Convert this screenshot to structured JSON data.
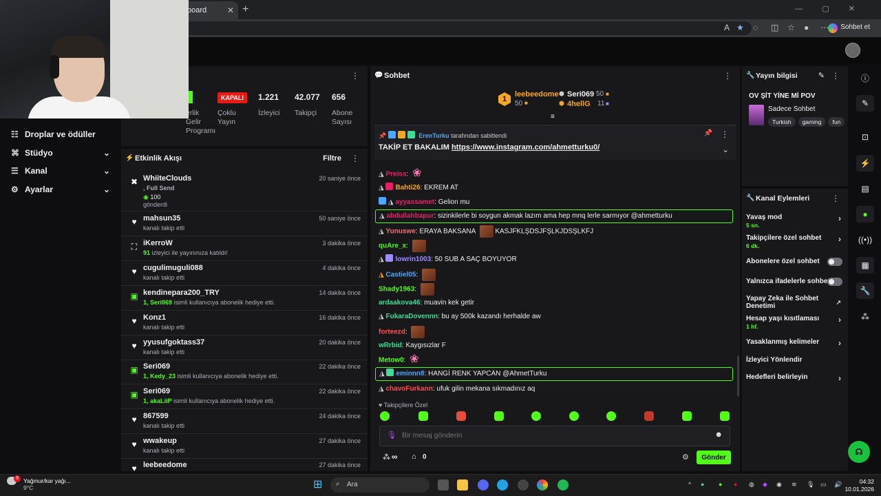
{
  "browser": {
    "tab_title": "board",
    "copilot_label": "Sohbet et"
  },
  "sidebar": {
    "items": [
      {
        "label": "Droplar ve ödüller",
        "icon": "gift-icon",
        "chevron": false
      },
      {
        "label": "Stüdyo",
        "icon": "studio-icon",
        "chevron": true
      },
      {
        "label": "Kanal",
        "icon": "channel-icon",
        "chevron": true
      },
      {
        "label": "Ayarlar",
        "icon": "gear-icon",
        "chevron": true
      }
    ]
  },
  "stats": {
    "partial_label_1": "erlik",
    "partial_label_2": "Gelir",
    "partial_label_3": "Programı",
    "status_badge": "KAPALI",
    "status_label_1": "Çoklu",
    "status_label_2": "Yayın",
    "viewers_value": "1.221",
    "viewers_label": "İzleyici",
    "followers_value": "42.077",
    "followers_label": "Takipçi",
    "subs_value": "656",
    "subs_label_1": "Abone",
    "subs_label_2": "Sayısı"
  },
  "activity": {
    "title": "Etkinlik Akışı",
    "filter_label": "Filtre",
    "events": [
      {
        "name": "WhiiteClouds",
        "desc_prefix": ", Full Send",
        "desc_line2": "100",
        "desc_line3": "gönderdi",
        "time": "20 saniye önce",
        "icon": "kick-icon"
      },
      {
        "name": "mahsun35",
        "desc": "kanalı takip etti",
        "time": "50 saniye önce",
        "icon": "heart-icon"
      },
      {
        "name": "iKerroW",
        "desc_green": "91",
        "desc": " izleyici ile yayınınıza katıldı!",
        "time": "3 dakika önce",
        "icon": "raid-icon"
      },
      {
        "name": "cugulimuguli088",
        "desc": "kanalı takip etti",
        "time": "4 dakika önce",
        "icon": "heart-icon"
      },
      {
        "name": "kendinepara200_TRY",
        "desc_green": "1, Seri069",
        "desc": " isimli kullanıcıya abonelik hediye etti.",
        "time": "14 dakika önce",
        "icon": "gift-icon"
      },
      {
        "name": "Konz1",
        "desc": "kanalı takip etti",
        "time": "16 dakika önce",
        "icon": "heart-icon"
      },
      {
        "name": "yyusufgoktass37",
        "desc": "kanalı takip etti",
        "time": "20 dakika önce",
        "icon": "heart-icon"
      },
      {
        "name": "Seri069",
        "desc_green": "1, Kedy_23",
        "desc": " isimli kullanıcıya abonelik hediye etti.",
        "time": "22 dakika önce",
        "icon": "gift-icon"
      },
      {
        "name": "Seri069",
        "desc_green": "1, akaLiiP",
        "desc": " isimli kullanıcıya abonelik hediye etti.",
        "time": "22 dakika önce",
        "icon": "gift-icon"
      },
      {
        "name": "867599",
        "desc": "kanalı takip etti",
        "time": "24 dakika önce",
        "icon": "heart-icon"
      },
      {
        "name": "wwakeup",
        "desc": "kanalı takip etti",
        "time": "27 dakika önce",
        "icon": "heart-icon"
      },
      {
        "name": "leebeedome",
        "desc": "",
        "time": "27 dakika önce",
        "icon": "heart-icon"
      }
    ]
  },
  "chat": {
    "title": "Sohbet",
    "leaderboard": {
      "first_name": "leebeedome",
      "first_rank": "1",
      "first_count": "50",
      "second_name": "Seri069",
      "second_count": "50",
      "third_name": "4hellG",
      "third_count": "11"
    },
    "pinned": {
      "by_user": "ErenTurku",
      "by_suffix": "tarafından sabitlendi",
      "message_text": "TAKİP ET BAKALIM ",
      "message_link": "https://www.instagram.com/ahmetturku0/"
    },
    "messages": [
      {
        "user": "Preiss",
        "color": "#e91e63",
        "text": "",
        "emote": "pink"
      },
      {
        "user": "Bahti26",
        "color": "#f5a623",
        "text": "EKREM AT"
      },
      {
        "user": "ayyassamet",
        "color": "#e91e63",
        "text": "Gelion mu"
      },
      {
        "user": "abdullahbapur",
        "color": "#e91e63",
        "text": "sizinkilerle bi soygun akmak lazım ama hep mnq lerle sarmıyor @ahmetturku",
        "highlight": true
      },
      {
        "user": "Yunuswe",
        "color": "#ff6b6b",
        "text": "ERAYA BAKSANA",
        "text2": "KASJFKLŞDSJFŞLKJDSŞLKFJ"
      },
      {
        "user": "quAre_x",
        "color": "#53fc18",
        "text": ""
      },
      {
        "user": "lowrin1003",
        "color": "#9b8cff",
        "text": "50 SUB A SAÇ BOYUYOR"
      },
      {
        "user": "Castiel05",
        "color": "#4aa8ff",
        "text": ""
      },
      {
        "user": "Shady1963",
        "color": "#53fc18",
        "text": ""
      },
      {
        "user": "ardaakova46",
        "color": "#3ddc97",
        "text": "muavin kek getir"
      },
      {
        "user": "FukaraDovennn",
        "color": "#3ddc97",
        "text": "bu ay 500k kazandı herhalde aw"
      },
      {
        "user": "forteezd",
        "color": "#ff4d4d",
        "text": ""
      },
      {
        "user": "wRrbid",
        "color": "#3ddc97",
        "text": "Kaygısızlar F"
      },
      {
        "user": "Metow0",
        "color": "#53fc18",
        "text": ""
      },
      {
        "user": "eminnn8",
        "color": "#4aa8ff",
        "text": "HANGİ RENK YAPCAN @AhmetTurku",
        "highlight": true
      },
      {
        "user": "chavoFurkann",
        "color": "#ff4d4d",
        "text": "ufuk gilin mekana sıkmadınız aq"
      }
    ],
    "followers_only": "Takipçilere Özel",
    "input_placeholder": "Bir mesaj gönderin",
    "send_label": "Gönder",
    "viewers_infinity": "∞",
    "points_value": "0"
  },
  "stream_info": {
    "title": "Yayın bilgisi",
    "stream_title": "OV ŞİT YİNE Mİ POV",
    "category": "Sadece Sohbet",
    "tags": [
      "Turkish",
      "gaming",
      "fun"
    ]
  },
  "channel_actions": {
    "title": "Kanal Eylemleri",
    "items": [
      {
        "label": "Yavaş mod",
        "sub": "5 sn.",
        "control": "chevron"
      },
      {
        "label": "Takipçilere özel sohbet",
        "sub": "6 dk.",
        "control": "chevron"
      },
      {
        "label": "Abonelere özel sohbet",
        "sub": "",
        "control": "toggle"
      },
      {
        "label": "Yalnızca ifadelerle sohbet",
        "sub": "",
        "control": "toggle"
      },
      {
        "label": "Yapay Zeka ile Sohbet Denetimi",
        "sub": "",
        "control": "external"
      },
      {
        "label": "Hesap yaşı kısıtlaması",
        "sub": "1 hf.",
        "control": "chevron"
      },
      {
        "label": "Yasaklanmış kelimeler",
        "sub": "",
        "control": "chevron"
      },
      {
        "label": "İzleyici Yönlendir",
        "sub": "",
        "control": "none"
      },
      {
        "label": "Hedefleri belirleyin",
        "sub": "",
        "control": "chevron"
      }
    ]
  },
  "taskbar": {
    "weather_line1": "Yağmur/kar yağı...",
    "weather_line2": "9°C",
    "weather_badge": "9",
    "search_label": "Ara",
    "time": "04:32",
    "date": "10.01.2026"
  },
  "colors": {
    "accent": "#53fc18",
    "panel": "#18181b",
    "background": "#0e0e10",
    "live_badge": "#e91916"
  }
}
